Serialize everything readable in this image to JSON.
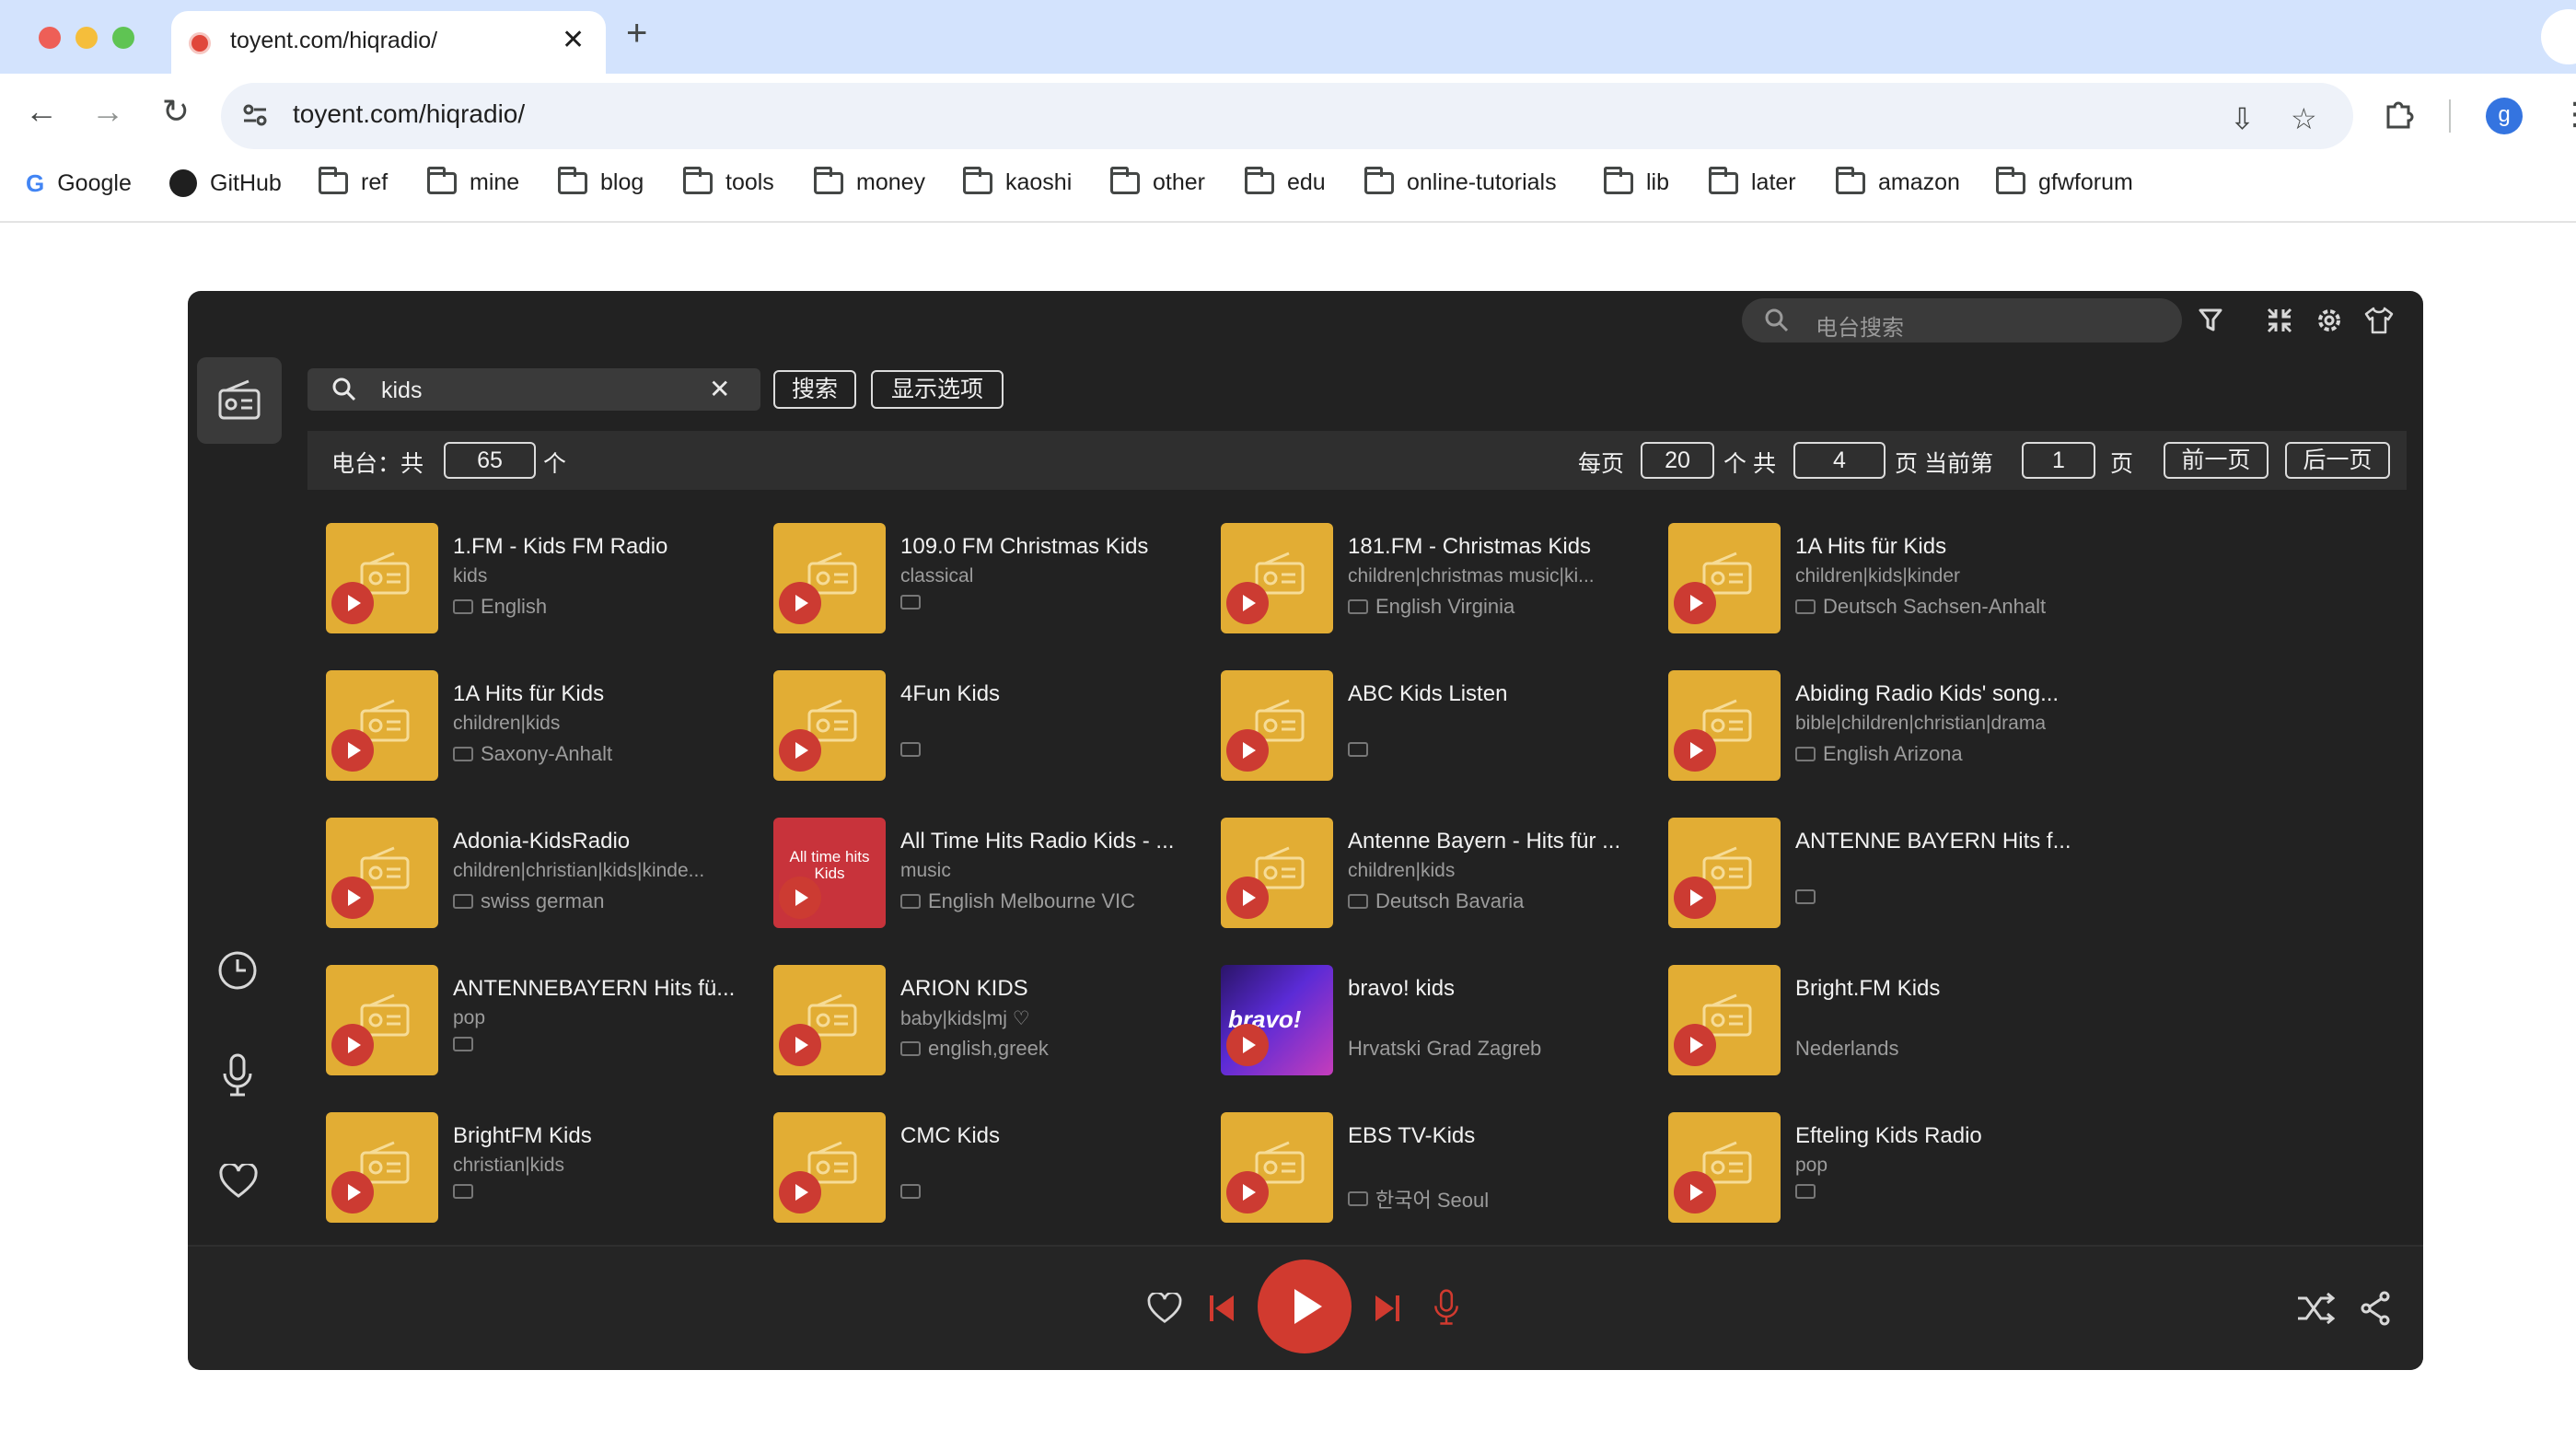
{
  "browser": {
    "tab_title": "toyent.com/hiqradio/",
    "url": "toyent.com/hiqradio/",
    "profile_initial": "g",
    "bookmarks": [
      "Google",
      "GitHub",
      "ref",
      "mine",
      "blog",
      "tools",
      "money",
      "kaoshi",
      "other",
      "edu",
      "online-tutorials",
      "lib",
      "later",
      "amazon",
      "gfwforum"
    ]
  },
  "app": {
    "top_search_placeholder": "电台搜索",
    "search_query": "kids",
    "search_button": "搜索",
    "display_options_button": "显示选项",
    "stations_label": "电台：共",
    "stations_total": "65",
    "stations_unit": "个",
    "per_page_label": "每页",
    "per_page": "20",
    "total_pages_label": "个 共",
    "total_pages": "4",
    "current_page_label": "页 当前第",
    "current_page": "1",
    "page_unit": "页",
    "prev_button": "前一页",
    "next_button": "后一页"
  },
  "stations": [
    {
      "name": "1.FM - Kids FM Radio",
      "tags": "kids",
      "location": "English"
    },
    {
      "name": "109.0 FM Christmas Kids",
      "tags": "classical",
      "location": ""
    },
    {
      "name": "181.FM - Christmas Kids",
      "tags": "children|christmas music|ki...",
      "location": "English Virginia"
    },
    {
      "name": "1A Hits für Kids",
      "tags": "children|kids|kinder",
      "location": "Deutsch Sachsen-Anhalt"
    },
    {
      "name": "1A Hits für Kids",
      "tags": "children|kids",
      "location": "Saxony-Anhalt"
    },
    {
      "name": "4Fun Kids",
      "tags": "",
      "location": ""
    },
    {
      "name": "ABC Kids Listen",
      "tags": "",
      "location": ""
    },
    {
      "name": "Abiding Radio Kids' song...",
      "tags": "bible|children|christian|drama",
      "location": "English Arizona"
    },
    {
      "name": "Adonia-KidsRadio",
      "tags": "children|christian|kids|kinde...",
      "location": "swiss german"
    },
    {
      "name": "All Time Hits Radio Kids - ...",
      "tags": "music",
      "location": "English Melbourne VIC",
      "thumb_text": "All time hits Kids"
    },
    {
      "name": "Antenne Bayern - Hits für ...",
      "tags": "children|kids",
      "location": "Deutsch Bavaria"
    },
    {
      "name": "ANTENNE BAYERN Hits f...",
      "tags": "",
      "location": ""
    },
    {
      "name": "ANTENNEBAYERN Hits fü...",
      "tags": "pop",
      "location": ""
    },
    {
      "name": "ARION KIDS",
      "tags": "baby|kids|mj ♡",
      "location": "english,greek"
    },
    {
      "name": "bravo! kids",
      "tags": "",
      "location": "Hrvatski Grad Zagreb",
      "thumb_text": "bravo!"
    },
    {
      "name": "Bright.FM Kids",
      "tags": "",
      "location": "Nederlands"
    },
    {
      "name": "BrightFM Kids",
      "tags": "christian|kids",
      "location": ""
    },
    {
      "name": "CMC Kids",
      "tags": "",
      "location": ""
    },
    {
      "name": "EBS TV-Kids",
      "tags": "",
      "location": "한국어 Seoul"
    },
    {
      "name": "Efteling Kids Radio",
      "tags": "pop",
      "location": ""
    }
  ],
  "colors": {
    "app_bg": "#222222",
    "thumb_yellow": "#e2ad34",
    "accent_red": "#d13a2f",
    "tab_bar": "#d3e3fd"
  }
}
